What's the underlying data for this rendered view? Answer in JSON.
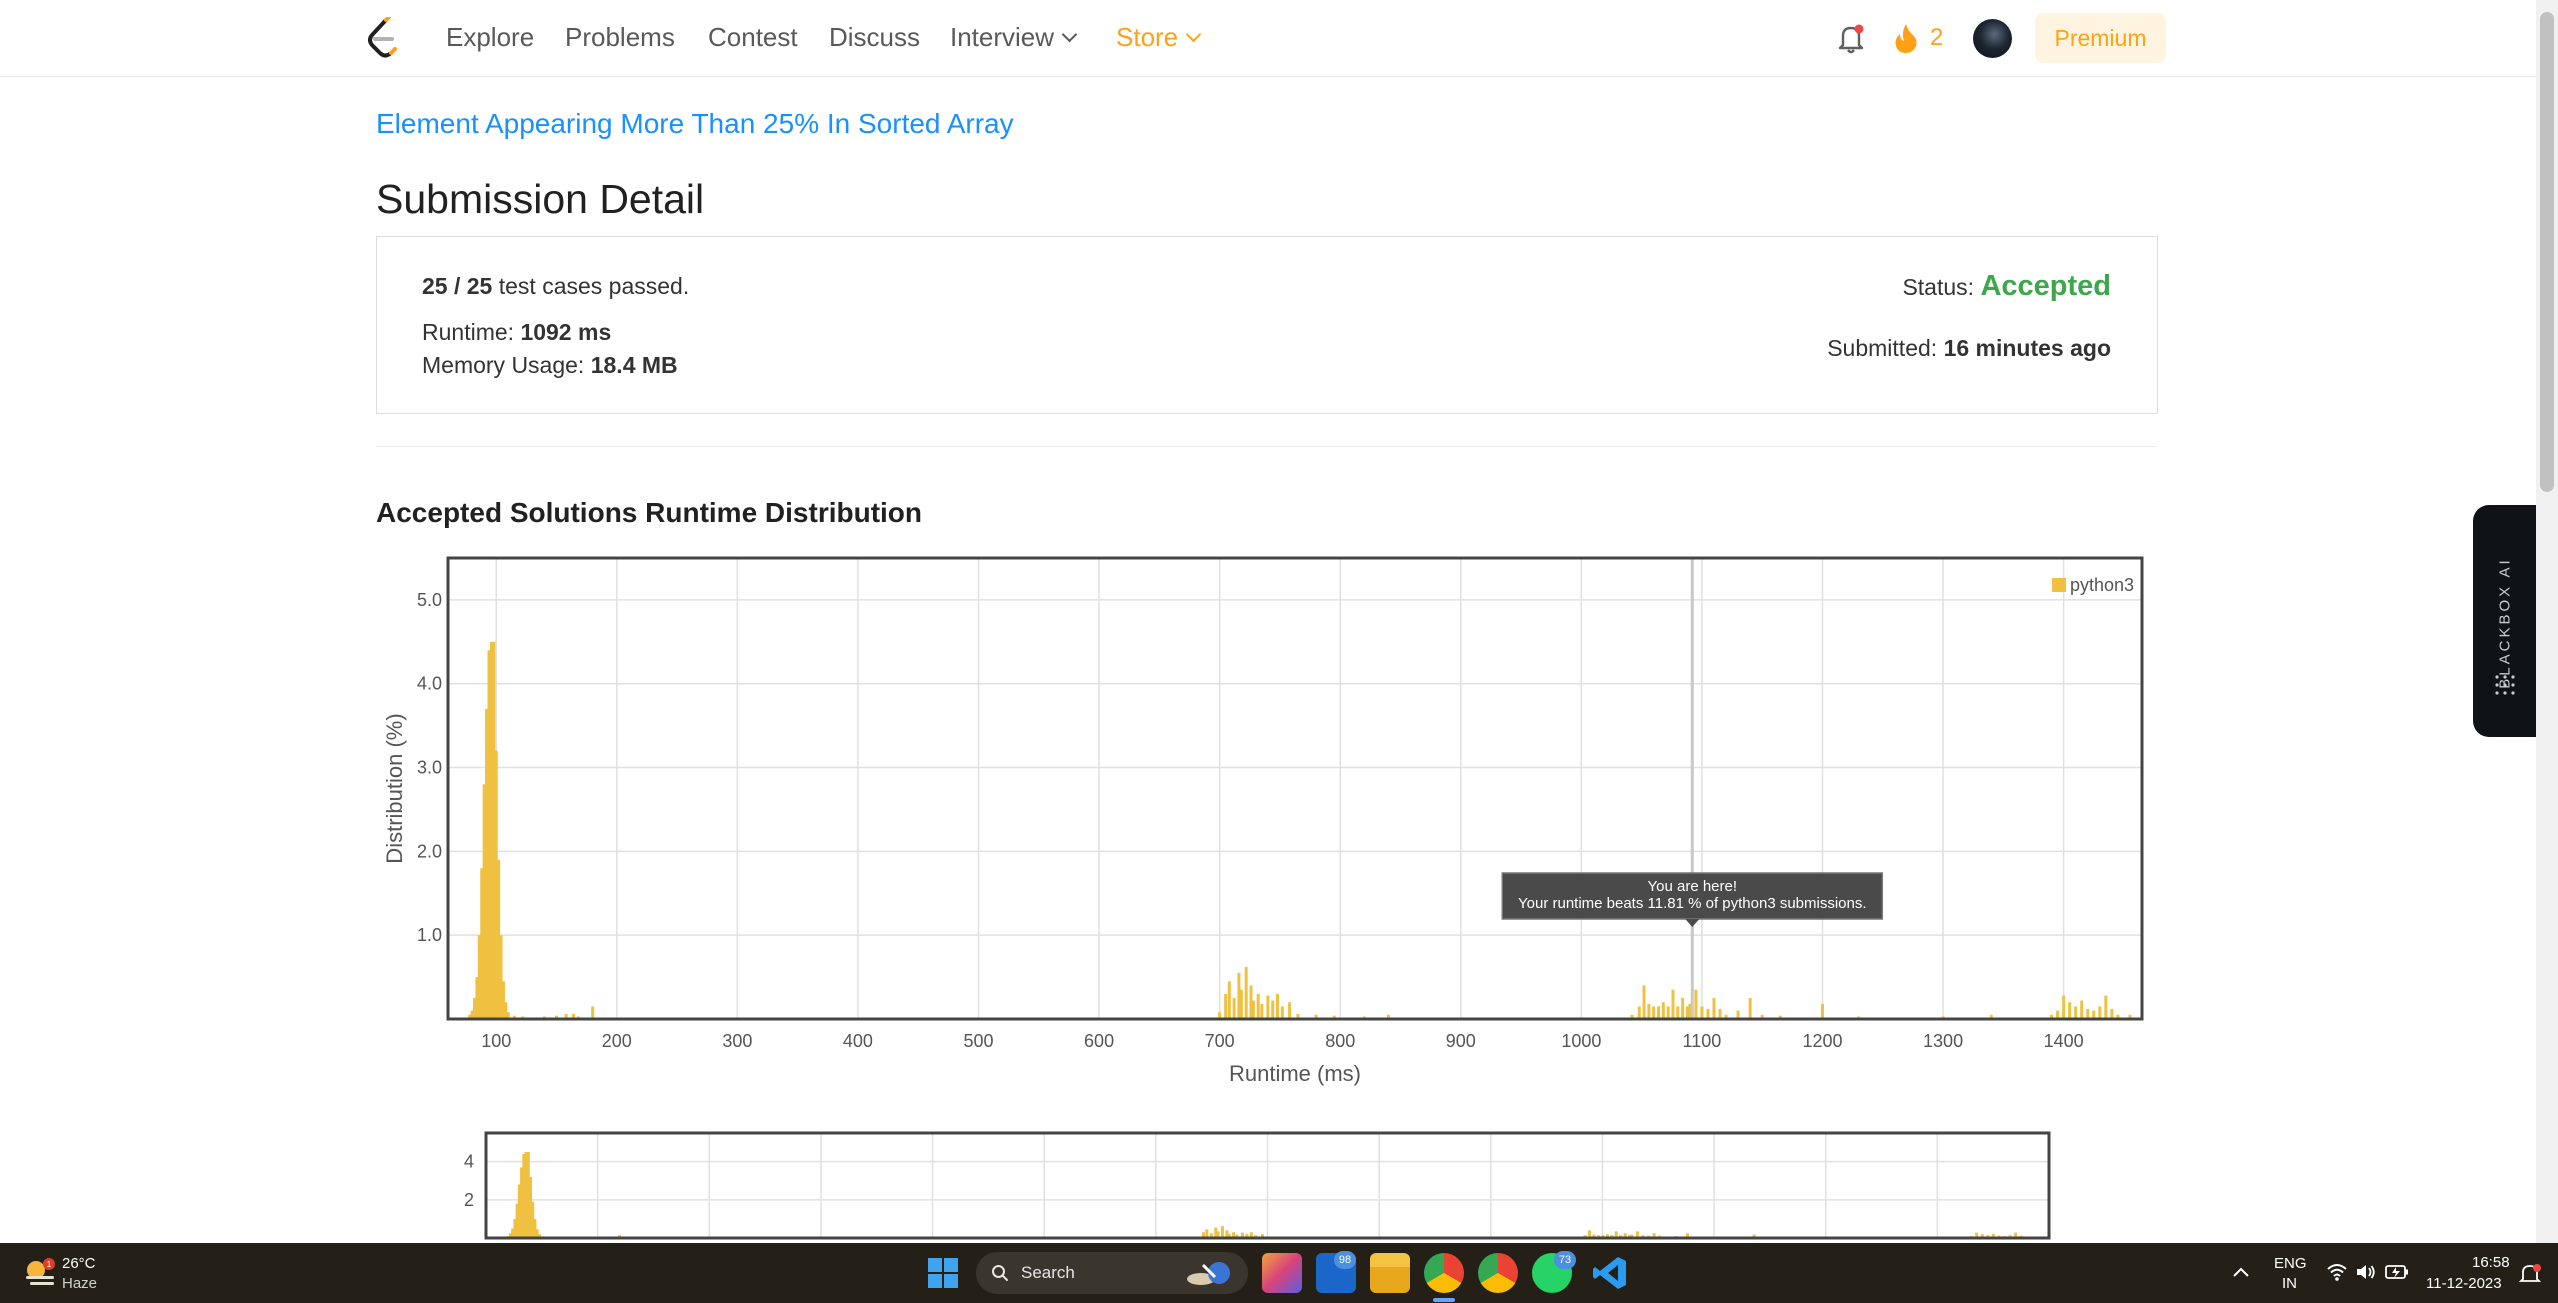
{
  "nav": {
    "items": [
      {
        "label": "Explore"
      },
      {
        "label": "Problems"
      },
      {
        "label": "Contest"
      },
      {
        "label": "Discuss"
      },
      {
        "label": "Interview"
      },
      {
        "label": "Store"
      }
    ],
    "streak_count": "2",
    "premium_label": "Premium"
  },
  "problem": {
    "title": "Element Appearing More Than 25% In Sorted Array"
  },
  "page_title": "Submission Detail",
  "submission": {
    "passed": "25 / 25",
    "passed_suffix": "test cases passed.",
    "status_label": "Status:",
    "status": "Accepted",
    "runtime_label": "Runtime:",
    "runtime": "1092 ms",
    "memory_label": "Memory Usage:",
    "memory": "18.4 MB",
    "submitted_label": "Submitted:",
    "submitted": "16 minutes ago"
  },
  "section_title": "Accepted Solutions Runtime Distribution",
  "chart_data": {
    "type": "bar",
    "xlabel": "Runtime (ms)",
    "ylabel": "Distribution (%)",
    "xlim": [
      60,
      1465
    ],
    "ylim": [
      0,
      5.5
    ],
    "xticks": [
      100,
      200,
      300,
      400,
      500,
      600,
      700,
      800,
      900,
      1000,
      1100,
      1200,
      1300,
      1400
    ],
    "yticks": [
      1.0,
      2.0,
      3.0,
      4.0,
      5.0
    ],
    "grid": true,
    "legend_position": "top-right",
    "series": [
      {
        "name": "python3",
        "color": "#f0c040",
        "points": [
          [
            78,
            0.05
          ],
          [
            80,
            0.1
          ],
          [
            82,
            0.25
          ],
          [
            84,
            0.5
          ],
          [
            86,
            1.0
          ],
          [
            88,
            1.8
          ],
          [
            90,
            2.8
          ],
          [
            92,
            3.7
          ],
          [
            94,
            4.4
          ],
          [
            96,
            4.5
          ],
          [
            98,
            4.5
          ],
          [
            100,
            3.2
          ],
          [
            102,
            1.9
          ],
          [
            104,
            1.0
          ],
          [
            106,
            0.45
          ],
          [
            108,
            0.2
          ],
          [
            110,
            0.08
          ],
          [
            115,
            0.04
          ],
          [
            122,
            0.03
          ],
          [
            140,
            0.03
          ],
          [
            150,
            0.04
          ],
          [
            158,
            0.06
          ],
          [
            164,
            0.06
          ],
          [
            168,
            0.03
          ],
          [
            180,
            0.15
          ],
          [
            700,
            0.08
          ],
          [
            705,
            0.3
          ],
          [
            708,
            0.45
          ],
          [
            712,
            0.25
          ],
          [
            716,
            0.55
          ],
          [
            718,
            0.35
          ],
          [
            722,
            0.62
          ],
          [
            726,
            0.4
          ],
          [
            728,
            0.22
          ],
          [
            732,
            0.3
          ],
          [
            735,
            0.18
          ],
          [
            740,
            0.28
          ],
          [
            744,
            0.22
          ],
          [
            748,
            0.3
          ],
          [
            752,
            0.15
          ],
          [
            758,
            0.2
          ],
          [
            765,
            0.06
          ],
          [
            780,
            0.05
          ],
          [
            795,
            0.04
          ],
          [
            820,
            0.03
          ],
          [
            840,
            0.05
          ],
          [
            1042,
            0.05
          ],
          [
            1048,
            0.15
          ],
          [
            1052,
            0.4
          ],
          [
            1056,
            0.18
          ],
          [
            1060,
            0.15
          ],
          [
            1064,
            0.15
          ],
          [
            1068,
            0.2
          ],
          [
            1072,
            0.15
          ],
          [
            1076,
            0.35
          ],
          [
            1080,
            0.15
          ],
          [
            1084,
            0.25
          ],
          [
            1088,
            0.15
          ],
          [
            1090,
            0.18
          ],
          [
            1095,
            0.35
          ],
          [
            1100,
            0.15
          ],
          [
            1105,
            0.12
          ],
          [
            1110,
            0.25
          ],
          [
            1115,
            0.12
          ],
          [
            1120,
            0.05
          ],
          [
            1130,
            0.1
          ],
          [
            1140,
            0.25
          ],
          [
            1150,
            0.05
          ],
          [
            1165,
            0.04
          ],
          [
            1200,
            0.18
          ],
          [
            1230,
            0.03
          ],
          [
            1300,
            0.03
          ],
          [
            1340,
            0.05
          ],
          [
            1390,
            0.05
          ],
          [
            1395,
            0.1
          ],
          [
            1400,
            0.28
          ],
          [
            1405,
            0.2
          ],
          [
            1410,
            0.15
          ],
          [
            1415,
            0.22
          ],
          [
            1420,
            0.12
          ],
          [
            1425,
            0.1
          ],
          [
            1430,
            0.15
          ],
          [
            1435,
            0.28
          ],
          [
            1440,
            0.12
          ],
          [
            1445,
            0.05
          ],
          [
            1455,
            0.05
          ]
        ]
      }
    ],
    "marker": {
      "x": 1092
    },
    "tooltip": {
      "line1": "You are here!",
      "line2": "Your runtime beats 11.81 % of python3 submissions."
    },
    "navigator": {
      "yticks": [
        2,
        4
      ]
    }
  },
  "blackbox": {
    "label": "BLACKBOX AI"
  },
  "taskbar": {
    "weather_temp": "26°C",
    "weather_cond": "Haze",
    "search_label": "Search",
    "outlook_badge": "98",
    "whatsapp_badge": "73",
    "lang_line1": "ENG",
    "lang_line2": "IN",
    "time": "16:58",
    "date": "11-12-2023"
  }
}
